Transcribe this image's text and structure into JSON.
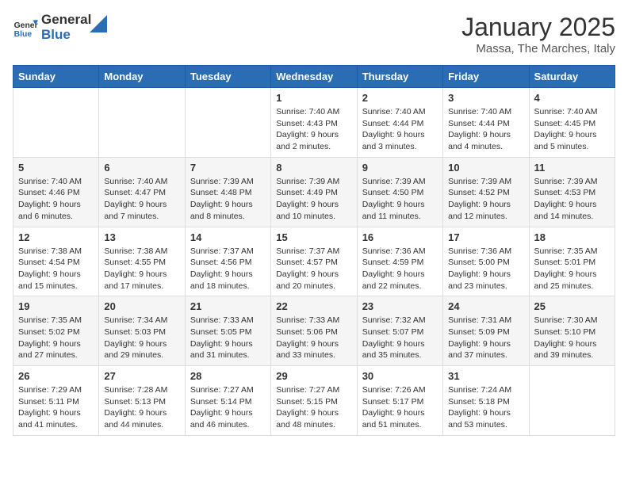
{
  "header": {
    "logo_general": "General",
    "logo_blue": "Blue",
    "title": "January 2025",
    "location": "Massa, The Marches, Italy"
  },
  "weekdays": [
    "Sunday",
    "Monday",
    "Tuesday",
    "Wednesday",
    "Thursday",
    "Friday",
    "Saturday"
  ],
  "weeks": [
    [
      {
        "day": "",
        "info": ""
      },
      {
        "day": "",
        "info": ""
      },
      {
        "day": "",
        "info": ""
      },
      {
        "day": "1",
        "info": "Sunrise: 7:40 AM\nSunset: 4:43 PM\nDaylight: 9 hours and 2 minutes."
      },
      {
        "day": "2",
        "info": "Sunrise: 7:40 AM\nSunset: 4:44 PM\nDaylight: 9 hours and 3 minutes."
      },
      {
        "day": "3",
        "info": "Sunrise: 7:40 AM\nSunset: 4:44 PM\nDaylight: 9 hours and 4 minutes."
      },
      {
        "day": "4",
        "info": "Sunrise: 7:40 AM\nSunset: 4:45 PM\nDaylight: 9 hours and 5 minutes."
      }
    ],
    [
      {
        "day": "5",
        "info": "Sunrise: 7:40 AM\nSunset: 4:46 PM\nDaylight: 9 hours and 6 minutes."
      },
      {
        "day": "6",
        "info": "Sunrise: 7:40 AM\nSunset: 4:47 PM\nDaylight: 9 hours and 7 minutes."
      },
      {
        "day": "7",
        "info": "Sunrise: 7:39 AM\nSunset: 4:48 PM\nDaylight: 9 hours and 8 minutes."
      },
      {
        "day": "8",
        "info": "Sunrise: 7:39 AM\nSunset: 4:49 PM\nDaylight: 9 hours and 10 minutes."
      },
      {
        "day": "9",
        "info": "Sunrise: 7:39 AM\nSunset: 4:50 PM\nDaylight: 9 hours and 11 minutes."
      },
      {
        "day": "10",
        "info": "Sunrise: 7:39 AM\nSunset: 4:52 PM\nDaylight: 9 hours and 12 minutes."
      },
      {
        "day": "11",
        "info": "Sunrise: 7:39 AM\nSunset: 4:53 PM\nDaylight: 9 hours and 14 minutes."
      }
    ],
    [
      {
        "day": "12",
        "info": "Sunrise: 7:38 AM\nSunset: 4:54 PM\nDaylight: 9 hours and 15 minutes."
      },
      {
        "day": "13",
        "info": "Sunrise: 7:38 AM\nSunset: 4:55 PM\nDaylight: 9 hours and 17 minutes."
      },
      {
        "day": "14",
        "info": "Sunrise: 7:37 AM\nSunset: 4:56 PM\nDaylight: 9 hours and 18 minutes."
      },
      {
        "day": "15",
        "info": "Sunrise: 7:37 AM\nSunset: 4:57 PM\nDaylight: 9 hours and 20 minutes."
      },
      {
        "day": "16",
        "info": "Sunrise: 7:36 AM\nSunset: 4:59 PM\nDaylight: 9 hours and 22 minutes."
      },
      {
        "day": "17",
        "info": "Sunrise: 7:36 AM\nSunset: 5:00 PM\nDaylight: 9 hours and 23 minutes."
      },
      {
        "day": "18",
        "info": "Sunrise: 7:35 AM\nSunset: 5:01 PM\nDaylight: 9 hours and 25 minutes."
      }
    ],
    [
      {
        "day": "19",
        "info": "Sunrise: 7:35 AM\nSunset: 5:02 PM\nDaylight: 9 hours and 27 minutes."
      },
      {
        "day": "20",
        "info": "Sunrise: 7:34 AM\nSunset: 5:03 PM\nDaylight: 9 hours and 29 minutes."
      },
      {
        "day": "21",
        "info": "Sunrise: 7:33 AM\nSunset: 5:05 PM\nDaylight: 9 hours and 31 minutes."
      },
      {
        "day": "22",
        "info": "Sunrise: 7:33 AM\nSunset: 5:06 PM\nDaylight: 9 hours and 33 minutes."
      },
      {
        "day": "23",
        "info": "Sunrise: 7:32 AM\nSunset: 5:07 PM\nDaylight: 9 hours and 35 minutes."
      },
      {
        "day": "24",
        "info": "Sunrise: 7:31 AM\nSunset: 5:09 PM\nDaylight: 9 hours and 37 minutes."
      },
      {
        "day": "25",
        "info": "Sunrise: 7:30 AM\nSunset: 5:10 PM\nDaylight: 9 hours and 39 minutes."
      }
    ],
    [
      {
        "day": "26",
        "info": "Sunrise: 7:29 AM\nSunset: 5:11 PM\nDaylight: 9 hours and 41 minutes."
      },
      {
        "day": "27",
        "info": "Sunrise: 7:28 AM\nSunset: 5:13 PM\nDaylight: 9 hours and 44 minutes."
      },
      {
        "day": "28",
        "info": "Sunrise: 7:27 AM\nSunset: 5:14 PM\nDaylight: 9 hours and 46 minutes."
      },
      {
        "day": "29",
        "info": "Sunrise: 7:27 AM\nSunset: 5:15 PM\nDaylight: 9 hours and 48 minutes."
      },
      {
        "day": "30",
        "info": "Sunrise: 7:26 AM\nSunset: 5:17 PM\nDaylight: 9 hours and 51 minutes."
      },
      {
        "day": "31",
        "info": "Sunrise: 7:24 AM\nSunset: 5:18 PM\nDaylight: 9 hours and 53 minutes."
      },
      {
        "day": "",
        "info": ""
      }
    ]
  ]
}
